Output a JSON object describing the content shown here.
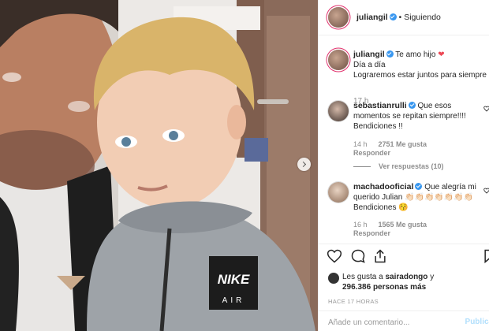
{
  "post_author": {
    "username": "juliangil",
    "verified": true,
    "separator": "•",
    "follow_status": "Siguiendo"
  },
  "caption": {
    "username": "juliangil",
    "line1": "Te amo hijo",
    "emoji": "❤",
    "line2": "Día a día",
    "line3": "Lograremos estar juntos para siempre",
    "time": "17 h"
  },
  "comments": [
    {
      "username": "sebastianrulli",
      "verified": true,
      "text": "Que esos momentos se repitan siempre!!!! Bendiciones !!",
      "time": "14 h",
      "likes": "2751 Me gusta",
      "reply_label": "Responder",
      "view_replies": "Ver respuestas (10)"
    },
    {
      "username": "machadooficial",
      "verified": true,
      "text": "Que alegría mi querido Julian 👏🏻👏🏻👏🏻👏🏻👏🏻👏🏻👏🏻 Bendiciones 😚",
      "time": "16 h",
      "likes": "1565 Me gusta",
      "reply_label": "Responder"
    }
  ],
  "likes_summary": {
    "line1_prefix": "Les gusta a",
    "liker": "sairadongo",
    "line1_suffix": "y",
    "count": "296.386",
    "count_suffix": "personas más"
  },
  "time_ago": "HACE 17 HORAS",
  "comment_box": {
    "placeholder": "Añade un comentario...",
    "publish_label": "Publicar"
  },
  "icons": {
    "like": "heart-icon",
    "comment": "comment-icon",
    "share": "share-icon",
    "save": "bookmark-icon",
    "next": "chevron-right-icon"
  },
  "colors": {
    "verified": "#3897f0",
    "heart": "#ed4956",
    "muted": "#8e8e8e",
    "publish": "#b2dffc"
  }
}
